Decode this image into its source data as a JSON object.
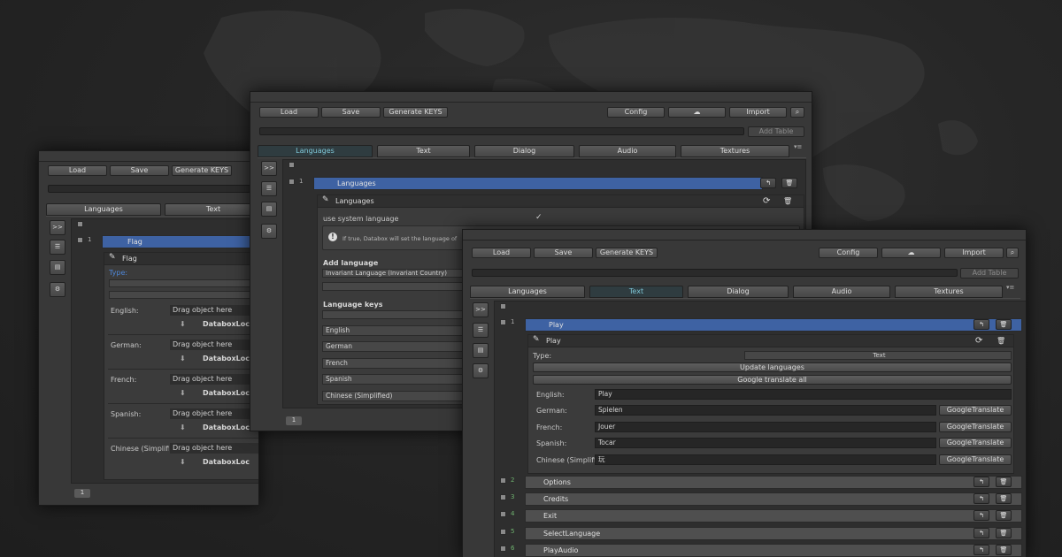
{
  "toolbar": {
    "load": "Load",
    "save": "Save",
    "generate_keys": "Generate KEYS",
    "config": "Config",
    "import": "Import",
    "add_table": "Add Table"
  },
  "tabs": [
    "Languages",
    "Text",
    "Dialog",
    "Audio",
    "Textures"
  ],
  "sidebar": {
    "expand": ">>"
  },
  "icons": {
    "cloud": "cloud-icon",
    "list": "list-icon",
    "document": "document-icon",
    "settings_doc": "document-settings-icon",
    "refresh": "refresh-icon",
    "trash": "trash-icon",
    "pin": "pin-icon",
    "pencil": "pencil-icon",
    "info": "info-icon",
    "object": "object-icon",
    "menu_dots": "menu-dots-icon"
  },
  "left": {
    "row_number": "1",
    "row_title": "Flag",
    "entry_title": "Flag",
    "type_label": "Type:",
    "fields": [
      {
        "label": "English:",
        "placeholder": "Drag object here",
        "value": "DataboxLoc"
      },
      {
        "label": "German:",
        "placeholder": "Drag object here",
        "value": "DataboxLoc"
      },
      {
        "label": "French:",
        "placeholder": "Drag object here",
        "value": "DataboxLoc"
      },
      {
        "label": "Spanish:",
        "placeholder": "Drag object here",
        "value": "DataboxLoc"
      },
      {
        "label": "Chinese (Simplifi",
        "placeholder": "Drag object here",
        "value": "DataboxLoc"
      }
    ],
    "page": "1"
  },
  "middle": {
    "row_number": "1",
    "row_title": "Languages",
    "entry_title": "Languages",
    "use_system_language": "use system language",
    "checkmark": "✓",
    "info_text": "If true, Databox will set the language of",
    "add_language": "Add language",
    "language_select": "Invariant Language (Invariant Country)",
    "language_keys": "Language keys",
    "keys": [
      "English",
      "German",
      "French",
      "Spanish",
      "Chinese (Simplified)"
    ],
    "page": "1"
  },
  "right": {
    "row_number": "1",
    "row_title": "Play",
    "entry_title": "Play",
    "type_label": "Type:",
    "type_value": "Text",
    "update_languages": "Update languages",
    "google_translate_all": "Google translate all",
    "google_translate": "GoogleTranslate",
    "fields": [
      {
        "label": "English:",
        "value": "Play"
      },
      {
        "label": "German:",
        "value": "Spielen"
      },
      {
        "label": "French:",
        "value": "Jouer"
      },
      {
        "label": "Spanish:",
        "value": "Tocar"
      },
      {
        "label": "Chinese (Simplifi",
        "value": "玩"
      }
    ],
    "rows": [
      {
        "num": "2",
        "title": "Options"
      },
      {
        "num": "3",
        "title": "Credits"
      },
      {
        "num": "4",
        "title": "Exit"
      },
      {
        "num": "5",
        "title": "SelectLanguage"
      },
      {
        "num": "6",
        "title": "PlayAudio"
      }
    ]
  },
  "colors": {
    "background": "#262626",
    "selected_row": "#3e62a3",
    "active_tab_text": "#7fc8d8",
    "row_number_green": "#6fb36f"
  }
}
